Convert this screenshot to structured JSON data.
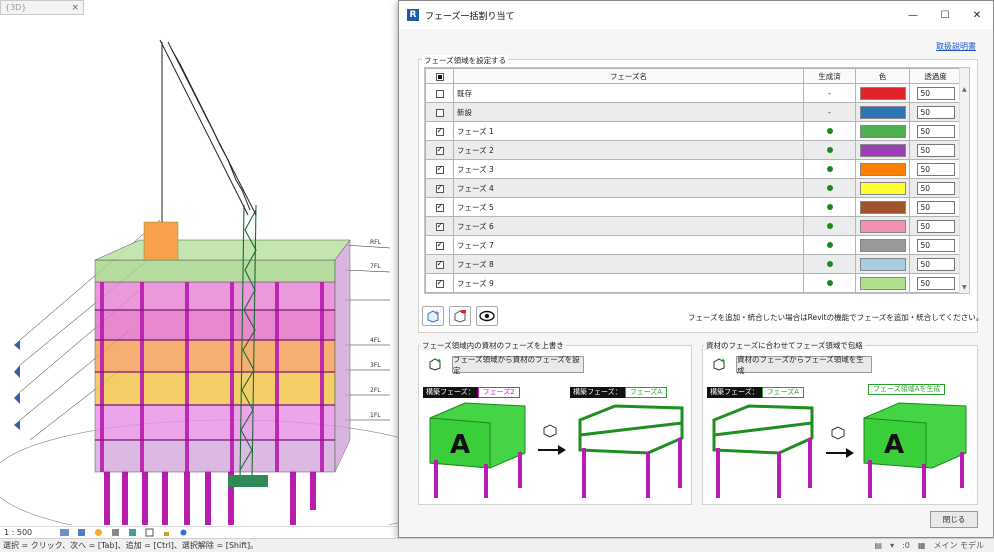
{
  "view": {
    "tab_label": "{3D}",
    "scale": "1 : 500",
    "level_labels": [
      "RFL",
      "7FL",
      "4FL",
      "3FL",
      "2FL",
      "1FL"
    ]
  },
  "status_bar": {
    "message": "選択 = クリック、次へ = [Tab]、追加 = [Ctrl]、選択解除 = [Shift]。",
    "zero": ":0",
    "model": "メイン モデル"
  },
  "dialog": {
    "title": "フェーズ一括割り当て",
    "manual_link": "取扱説明書",
    "phase_group_title": "フェーズ領域を設定する",
    "columns": [
      "フェーズ名",
      "生成済",
      "色",
      "透過度"
    ],
    "rows": [
      {
        "checked": false,
        "name": "既存",
        "generated": "-",
        "color": "#e0242a",
        "transparency": "50"
      },
      {
        "checked": false,
        "name": "新設",
        "generated": "-",
        "color": "#2e75b6",
        "transparency": "50"
      },
      {
        "checked": true,
        "name": "フェーズ 1",
        "generated": "●",
        "color": "#4caf50",
        "transparency": "50"
      },
      {
        "checked": true,
        "name": "フェーズ 2",
        "generated": "●",
        "color": "#9b3fb5",
        "transparency": "50"
      },
      {
        "checked": true,
        "name": "フェーズ 3",
        "generated": "●",
        "color": "#ff8000",
        "transparency": "50"
      },
      {
        "checked": true,
        "name": "フェーズ 4",
        "generated": "●",
        "color": "#ffff33",
        "transparency": "50"
      },
      {
        "checked": true,
        "name": "フェーズ 5",
        "generated": "●",
        "color": "#a0522d",
        "transparency": "50"
      },
      {
        "checked": true,
        "name": "フェーズ 6",
        "generated": "●",
        "color": "#f48fb1",
        "transparency": "50"
      },
      {
        "checked": true,
        "name": "フェーズ 7",
        "generated": "●",
        "color": "#999999",
        "transparency": "50"
      },
      {
        "checked": true,
        "name": "フェーズ 8",
        "generated": "●",
        "color": "#a6cde3",
        "transparency": "50"
      },
      {
        "checked": true,
        "name": "フェーズ 9",
        "generated": "●",
        "color": "#b2df8a",
        "transparency": "50"
      }
    ],
    "hint": "フェーズを追加・統合したい場合はRevitの機能でフェーズを追加・統合してください。",
    "left_section": {
      "title": "フェーズ領域内の資材のフェーズを上書き",
      "button": "フェーズ領域から資材のフェーズを設定",
      "tag1_key": "構築フェーズ：",
      "tag1_val": "フェーズ2",
      "tag2_key": "構築フェーズ：",
      "tag2_val": "フェーズA",
      "big_letter": "A"
    },
    "right_section": {
      "title": "資材のフェーズに合わせてフェーズ領域で包絡",
      "button": "資材のフェーズからフェーズ領域を生成",
      "tag1_key": "構築フェーズ：",
      "tag1_val": "フェーズA",
      "tag2_val": "フェーズ領域Aを生成",
      "big_letter": "A"
    },
    "close_label": "閉じる"
  }
}
